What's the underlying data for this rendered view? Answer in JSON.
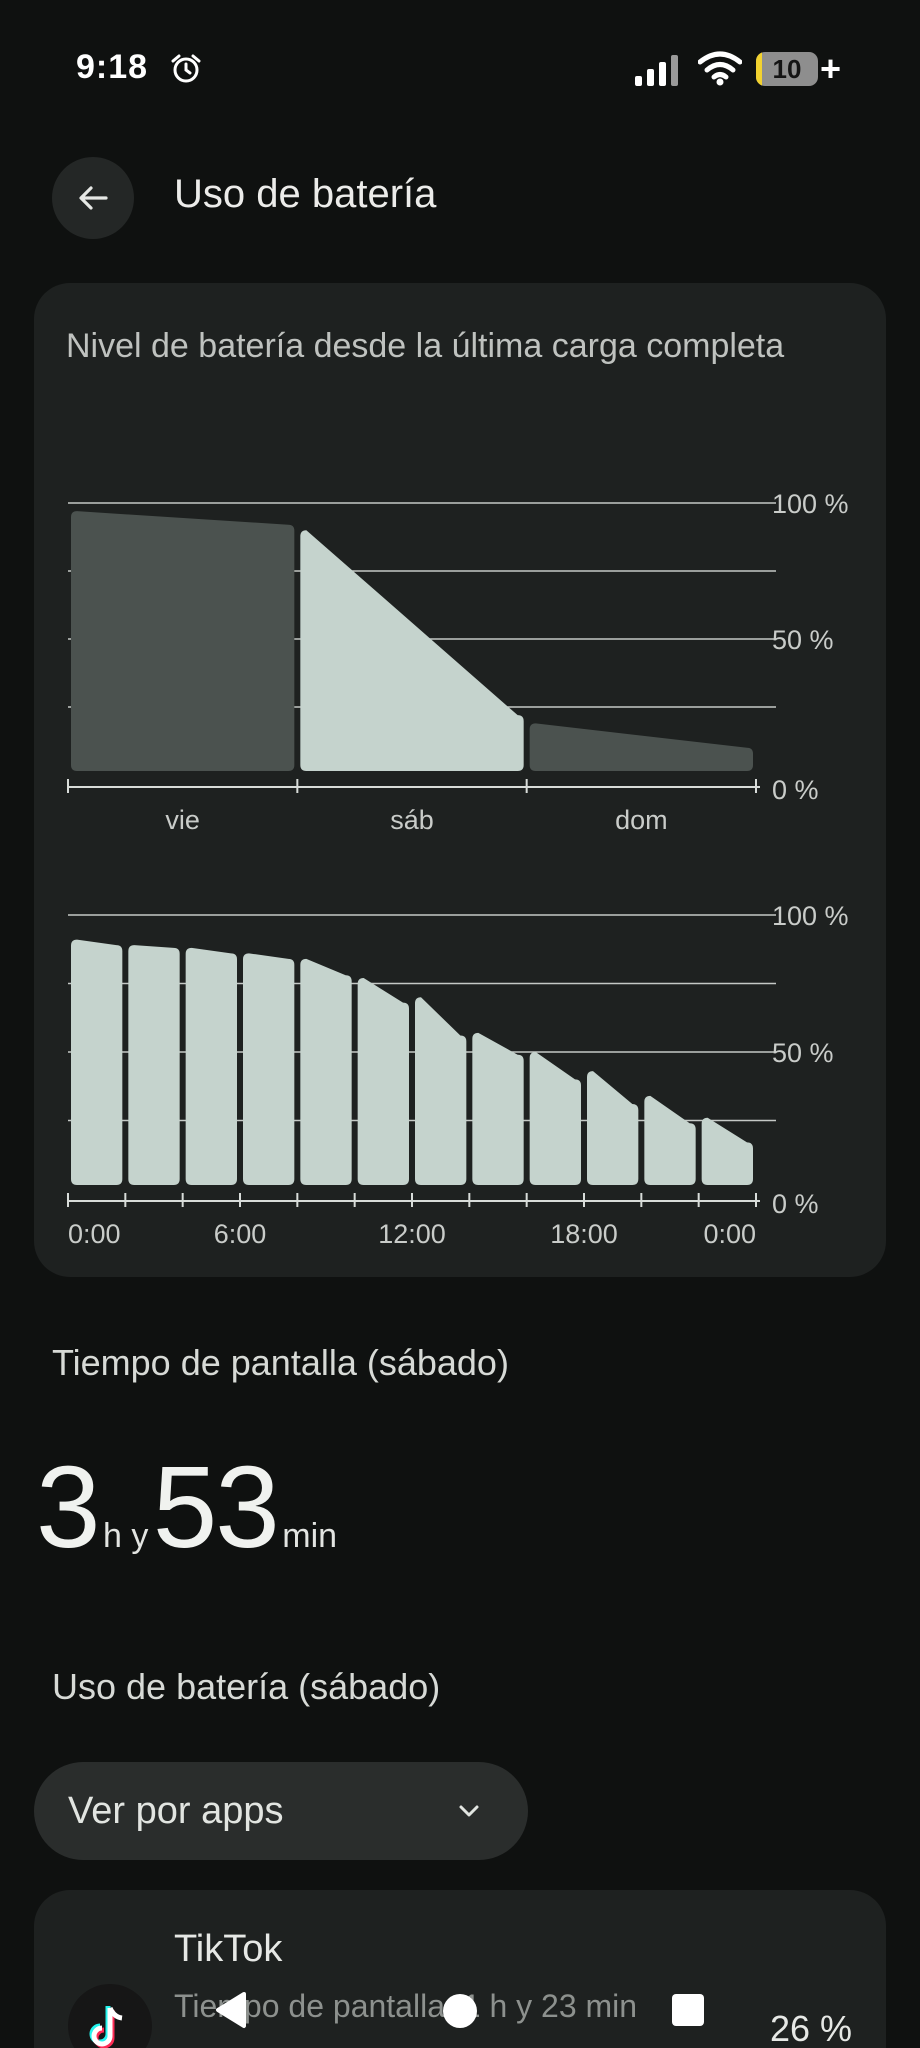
{
  "status_bar": {
    "time": "9:18",
    "battery_text": "10",
    "battery_level": 0.1,
    "charging_symbol": "+",
    "icons": [
      "alarm-icon",
      "signal-icon",
      "wifi-icon",
      "battery-icon"
    ]
  },
  "header": {
    "back_icon": "arrow-back-icon",
    "title": "Uso de batería"
  },
  "chart_card": {
    "title": "Nivel de batería desde la última carga completa",
    "colors": {
      "highlight": "#c5d3cd",
      "muted": "#4b524f",
      "grid": "#d8dcd9",
      "text": "#c9ccc9"
    }
  },
  "chart_data": [
    {
      "type": "area",
      "title": "",
      "categories": [
        "vie",
        "sáb",
        "dom"
      ],
      "y_tick_labels": [
        "100 %",
        "50 %",
        "0 %"
      ],
      "ylim": [
        0,
        100
      ],
      "selected_category": "sáb",
      "segments": [
        {
          "category": "vie",
          "start": 97,
          "end": 92
        },
        {
          "category": "sáb",
          "start": 90,
          "end": 22
        },
        {
          "category": "dom",
          "start": 19,
          "end": 10
        }
      ]
    },
    {
      "type": "bar",
      "title": "",
      "x_tick_labels": [
        "0:00",
        "6:00",
        "12:00",
        "18:00",
        "0:00"
      ],
      "y_tick_labels": [
        "100 %",
        "50 %",
        "0 %"
      ],
      "ylim": [
        0,
        100
      ],
      "bars": [
        {
          "start": 91,
          "end": 89
        },
        {
          "start": 89,
          "end": 88
        },
        {
          "start": 88,
          "end": 86
        },
        {
          "start": 86,
          "end": 84
        },
        {
          "start": 84,
          "end": 78
        },
        {
          "start": 77,
          "end": 68
        },
        {
          "start": 70,
          "end": 56
        },
        {
          "start": 57,
          "end": 49
        },
        {
          "start": 50,
          "end": 40
        },
        {
          "start": 43,
          "end": 31
        },
        {
          "start": 34,
          "end": 24
        },
        {
          "start": 26,
          "end": 17
        }
      ]
    }
  ],
  "screen_time": {
    "title": "Tiempo de pantalla (sábado)",
    "hours": "3",
    "hours_unit": "h y",
    "minutes": "53",
    "minutes_unit": "min"
  },
  "battery_usage": {
    "title": "Uso de batería (sábado)",
    "dropdown_label": "Ver por apps",
    "apps": [
      {
        "name": "TikTok",
        "detail": "Tiempo de pantalla: 1 h y 23 min",
        "percent": "26 %"
      }
    ]
  },
  "nav_bar": {
    "icons": [
      "nav-back-icon",
      "nav-home-icon",
      "nav-recents-icon"
    ]
  }
}
